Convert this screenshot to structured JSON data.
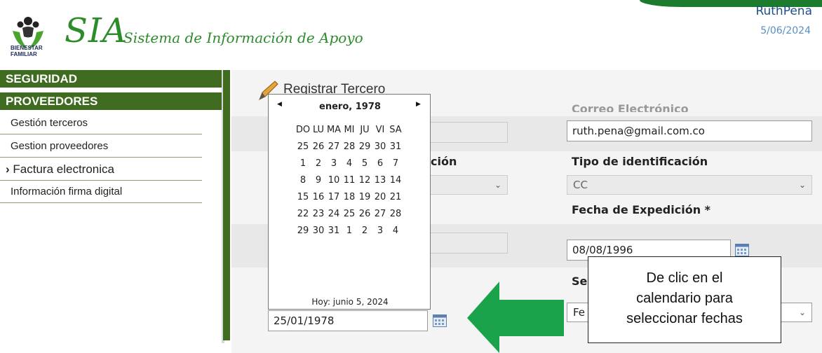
{
  "header": {
    "logo_caption_line1": "BIENESTAR",
    "logo_caption_line2": "FAMILIAR",
    "app_short": "SIA",
    "app_full": "Sistema de Información de Apoyo",
    "user": "RuthPena",
    "date": "5/06/2024"
  },
  "sidebar": {
    "sections": [
      {
        "label": "SEGURIDAD"
      },
      {
        "label": "PROVEEDORES"
      }
    ],
    "items": [
      {
        "label": "Gestión terceros"
      },
      {
        "label": "Gestion proveedores"
      },
      {
        "label": "Factura electronica",
        "arrow": "›"
      },
      {
        "label": "Información firma digital"
      }
    ]
  },
  "page": {
    "title": "Registrar Tercero",
    "email_label_partial": "Correo Electrónico",
    "email_value": "ruth.pena@gmail.com.co",
    "id_type_label_partial": "ción",
    "id_type_label": "Tipo de identificación",
    "id_type_value": "CC",
    "issue_date_label": "Fecha de Expedición *",
    "issue_date_value": "08/08/1996",
    "sex_label_partial": "Se",
    "sex_value_partial": "Fe",
    "birth_date_value": "25/01/1978"
  },
  "datepicker": {
    "prev": "◀",
    "next": "▶",
    "month": "enero, 1978",
    "weekdays": [
      "DO",
      "LU",
      "MA",
      "MI",
      "JU",
      "VI",
      "SA"
    ],
    "weeks": [
      [
        "25",
        "26",
        "27",
        "28",
        "29",
        "30",
        "31"
      ],
      [
        "1",
        "2",
        "3",
        "4",
        "5",
        "6",
        "7"
      ],
      [
        "8",
        "9",
        "10",
        "11",
        "12",
        "13",
        "14"
      ],
      [
        "15",
        "16",
        "17",
        "18",
        "19",
        "20",
        "21"
      ],
      [
        "22",
        "23",
        "24",
        "25",
        "26",
        "27",
        "28"
      ],
      [
        "29",
        "30",
        "31",
        "1",
        "2",
        "3",
        "4"
      ]
    ],
    "today": "Hoy: junio 5, 2024"
  },
  "tooltip": {
    "line1": "De clic en el",
    "line2": "calendario para",
    "line3": "seleccionar fechas"
  },
  "colors": {
    "sidebar_green": "#3f6b21",
    "brand_green": "#2c8c2a",
    "arrow_green": "#1aa34a"
  }
}
